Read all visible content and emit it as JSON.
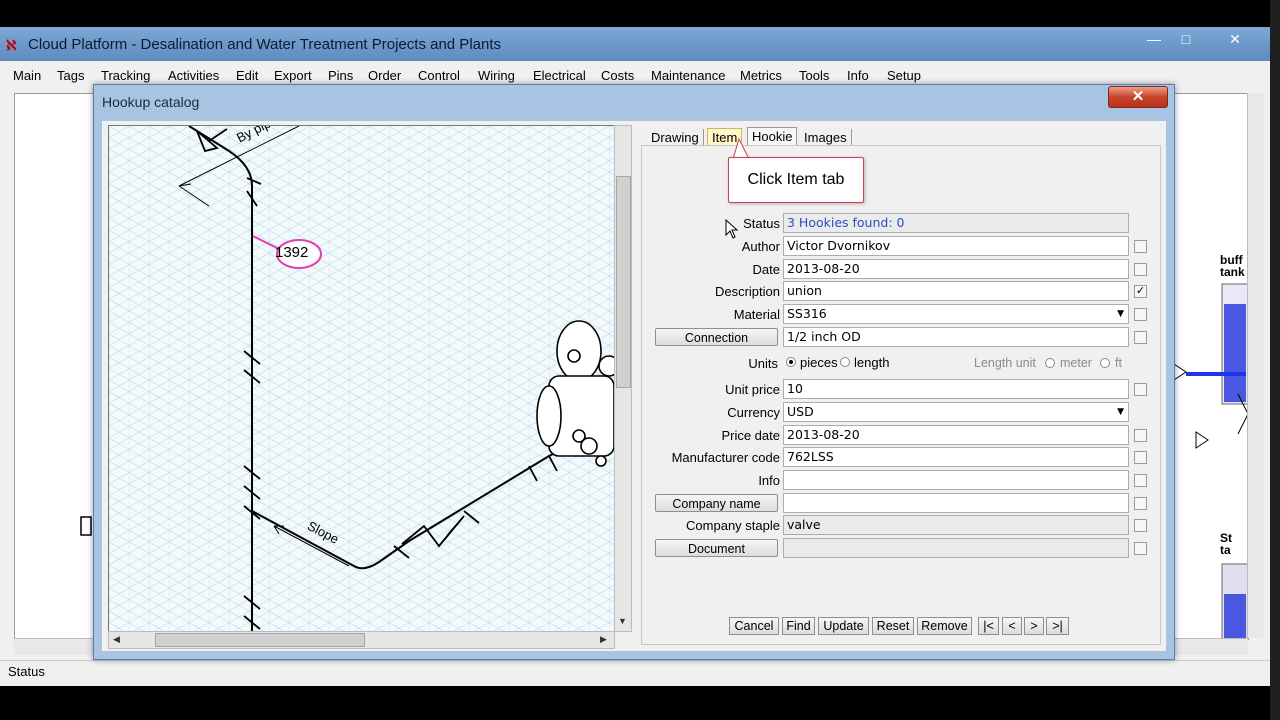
{
  "window": {
    "title": "Cloud Platform - Desalination and Water Treatment Projects and Plants",
    "controls": {
      "minimize": "—",
      "maximize": "□",
      "close": "✕"
    }
  },
  "menu": [
    "Main",
    "Tags",
    "Tracking",
    "Activities",
    "Edit",
    "Export",
    "Pins",
    "Order",
    "Control",
    "Wiring",
    "Electrical",
    "Costs",
    "Maintenance",
    "Metrics",
    "Tools",
    "Info",
    "Setup"
  ],
  "statusbar": {
    "text": "Status"
  },
  "background_labels": {
    "buffer_tank": "buff\ntank",
    "status_tank": "St\nta"
  },
  "dialog": {
    "title": "Hookup catalog",
    "close_label": "✕",
    "drawing": {
      "tag_label": "1392",
      "by_pipe_label": "By pipe",
      "slope_label": "Slope"
    },
    "tabs": [
      "Drawing",
      "Item",
      "Hookie",
      "Images"
    ],
    "active_tab": "Item",
    "callout": "Click Item tab",
    "fields": {
      "status": {
        "label": "Status",
        "value": "3 Hookies found: 0"
      },
      "author": {
        "label": "Author",
        "value": "Victor Dvornikov"
      },
      "date": {
        "label": "Date",
        "value": "2013-08-20"
      },
      "description": {
        "label": "Description",
        "value": "union"
      },
      "material": {
        "label": "Material",
        "value": "SS316"
      },
      "connection": {
        "label": "Connection",
        "value": "1/2 inch OD"
      },
      "units": {
        "label": "Units",
        "option1": "pieces",
        "option2": "length",
        "selected": "pieces"
      },
      "length_unit": {
        "label": "Length unit",
        "option1": "meter",
        "option2": "ft"
      },
      "unit_price": {
        "label": "Unit price",
        "value": "10"
      },
      "currency": {
        "label": "Currency",
        "value": "USD"
      },
      "price_date": {
        "label": "Price date",
        "value": "2013-08-20"
      },
      "manufacturer_code": {
        "label": "Manufacturer code",
        "value": "762LSS"
      },
      "info": {
        "label": "Info",
        "value": ""
      },
      "company_name": {
        "label": "Company name",
        "value": ""
      },
      "company_staple": {
        "label": "Company staple",
        "value": "valve"
      },
      "document": {
        "label": "Document",
        "value": ""
      }
    },
    "checked": {
      "description": true
    },
    "actions": [
      "Cancel",
      "Find",
      "Update",
      "Reset",
      "Remove",
      "|<",
      "<",
      ">",
      ">|"
    ]
  }
}
